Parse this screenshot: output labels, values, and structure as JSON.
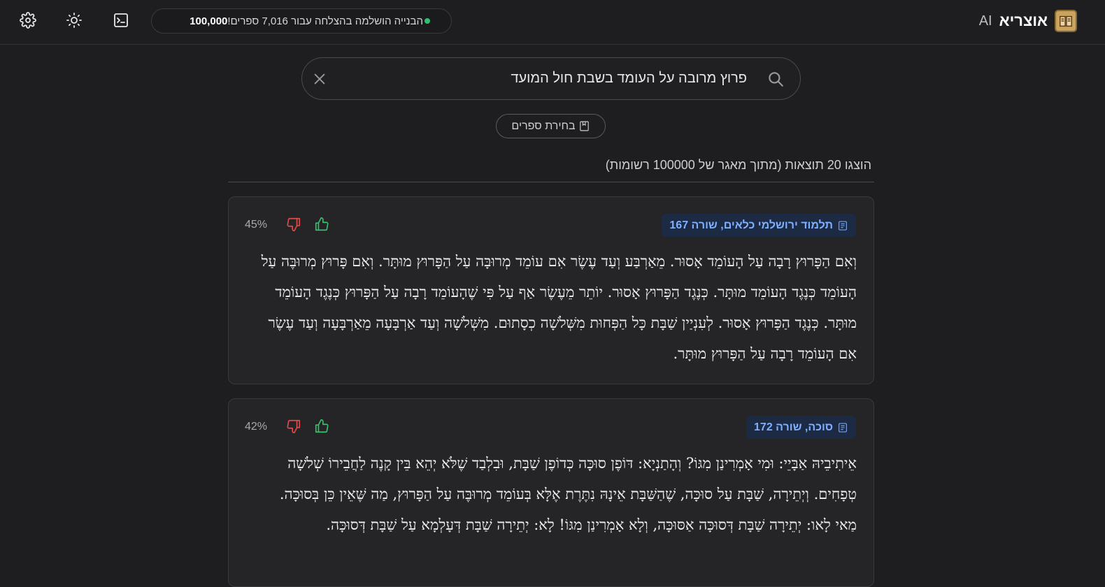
{
  "header": {
    "brand_name": "אוצריא",
    "brand_suffix": "AI",
    "status_text": "הבנייה הושלמה בהצלחה עבור 7,016 ספרים!",
    "status_count": "100,000",
    "status_color": "#2fbf71"
  },
  "icons": {
    "settings": "gear-icon",
    "theme": "sun-icon",
    "terminal": "terminal-icon",
    "search": "search-icon",
    "clear": "close-icon",
    "books": "book-icon",
    "source": "document-icon",
    "thumbs_up": "thumbs-up-icon",
    "thumbs_down": "thumbs-down-icon"
  },
  "search": {
    "query": "פרוץ מרובה על העומד בשבת חול המועד",
    "placeholder": ""
  },
  "books_button_label": "בחירת ספרים",
  "results_summary": "הוצגו 20 תוצאות (מתוך מאגר של 100000 רשומות)",
  "accent_color": "#7fb0ff",
  "results": [
    {
      "source": "תלמוד ירושלמי כלאים, שורה 167",
      "score": "45%",
      "text": "וְאִם הַפָּרוּץ רָבָה עַל הָעוֹמֵד אָסוּר. מֵאַרְבַּע וְעַד עֶשֶׂר אִם עוֹמֵד מְרוּבָּה עַל הַפָּרוּץ מוּתָּר. וְאִם פָּרוּץ מְרוּבֶּה עַל הָעוֹמֵד כְּנֶגֶד הָעוֹמֵד מוּתָּר. כְּנֶגֶד הַפָּרוּץ אָסוּר. יוֹתֵר מֵעֶשֶׂר אַף עַל פִּי שֶׁהָעוֹמֵד רָבָה עַל הַפָּרוּץ כְּנֶגֶד הָעוֹמֵד מוּתָּר. כְּנֶגֶד הַפָּרוּץ אָסוּר. לְעִנְיַין שַׁבָּת כָּל הַפְּחוּת מִשְּׁלֹשָׁה כְסָתוּם. מִשְּׁלֹשָׁה וְעַד אַרְבָּעָה מֵאַרְבָּעָה וְעַד עֶשֶׂר אִם הָעוֹמֵד רָבָה עַל הַפָּרוּץ מוּתָּר."
    },
    {
      "source": "סוכה, שורה 172",
      "score": "42%",
      "text": "אֵיתִיבֵיהּ אַבָּיֵי: וּמִי אָמְרִינַן מִגּוֹ? וְהָתַנְיָא: דּוֹפֶן סוּכָּה כְּדוֹפֶן שַׁבָּת, וּבִלְבַד שֶׁלֹּא יְהֵא בֵּין קָנֶה לַחֲבֵירוֹ שְׁלֹשָׁה טְפָחִים. וְיְתֵירָה, שַׁבָּת עַל סוּכָּה, שֶׁהַשַּׁבָּת אֵינָהּ נִתֶּרֶת אֶלָּא בְּעוֹמֵד מְרוּבֶּה עַל הַפָּרוּץ, מַה שֶּׁאֵין כֵּן בְּסוּכָּה. מַאי לָאו: יְתֵירָה שַׁבָּת דְּסוּכָּה אַסּוּכָּה, וְלָא אָמְרִינַן מִגּוֹ! לָא: יְתֵירָה שַׁבָּת דְּעָלְמָא עַל שַׁבָּת דְּסוּכָּה."
    }
  ]
}
